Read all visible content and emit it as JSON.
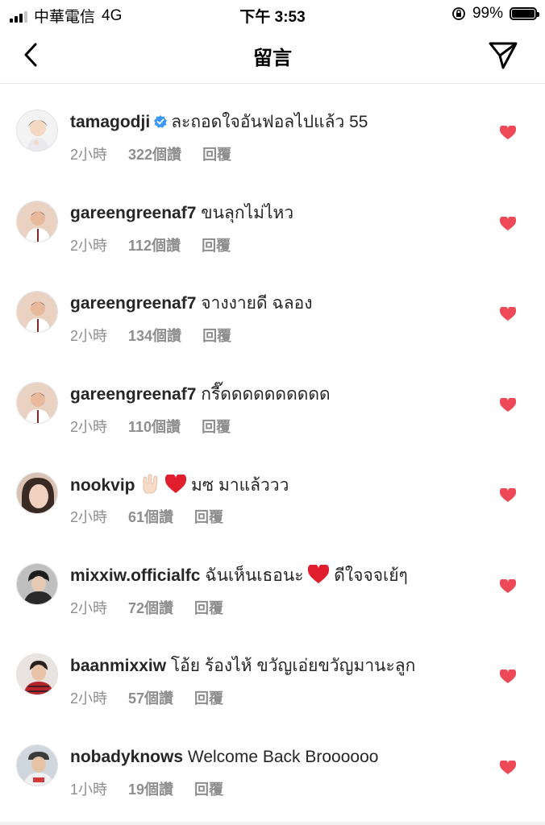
{
  "status_bar": {
    "carrier": "中華電信",
    "network": "4G",
    "time": "下午 3:53",
    "battery": "99%",
    "battery_level": 0.99
  },
  "nav": {
    "title": "留言",
    "back_icon": "chevron-left-icon",
    "send_icon": "paper-plane-icon"
  },
  "colors": {
    "like_red": "#ed4956",
    "meta_gray": "#8e8e8e",
    "verified_blue": "#3897f0"
  },
  "comments": [
    {
      "username": "tamagodji",
      "verified": true,
      "text": "ละถอดใจอันฟอลไปแล้ว 55",
      "time": "2小時",
      "likes": "322個讚",
      "reply": "回覆"
    },
    {
      "username": "gareengreenaf7",
      "text": "ขนลุกไม่ไหว",
      "time": "2小時",
      "likes": "112個讚",
      "reply": "回覆"
    },
    {
      "username": "gareengreenaf7",
      "text": "จางงายดี ฉลอง",
      "time": "2小時",
      "likes": "134個讚",
      "reply": "回覆"
    },
    {
      "username": "gareengreenaf7",
      "text": "กรี๊ดดดดดดดดดด",
      "time": "2小時",
      "likes": "110個讚",
      "reply": "回覆"
    },
    {
      "username": "nookvip",
      "text": "มซ มาแล้ววว",
      "emoji_before": [
        "love-you-gesture-emoji",
        "red-heart-emoji"
      ],
      "time": "2小時",
      "likes": "61個讚",
      "reply": "回覆"
    },
    {
      "username": "mixxiw.officialfc",
      "text": "ฉันเห็นเธอนะ",
      "text_after": "ดีใจจจเย้ๆ",
      "emoji_middle": "red-heart-emoji",
      "time": "2小時",
      "likes": "72個讚",
      "reply": "回覆"
    },
    {
      "username": "baanmixxiw",
      "text": "โอ้ย ร้องไห้ ขวัญเอ่ยขวัญมานะลูก",
      "time": "2小時",
      "likes": "57個讚",
      "reply": "回覆"
    },
    {
      "username": "nobadyknows",
      "text": "Welcome Back Broooooo",
      "time": "1小時",
      "likes": "19個讚",
      "reply": "回覆"
    }
  ]
}
